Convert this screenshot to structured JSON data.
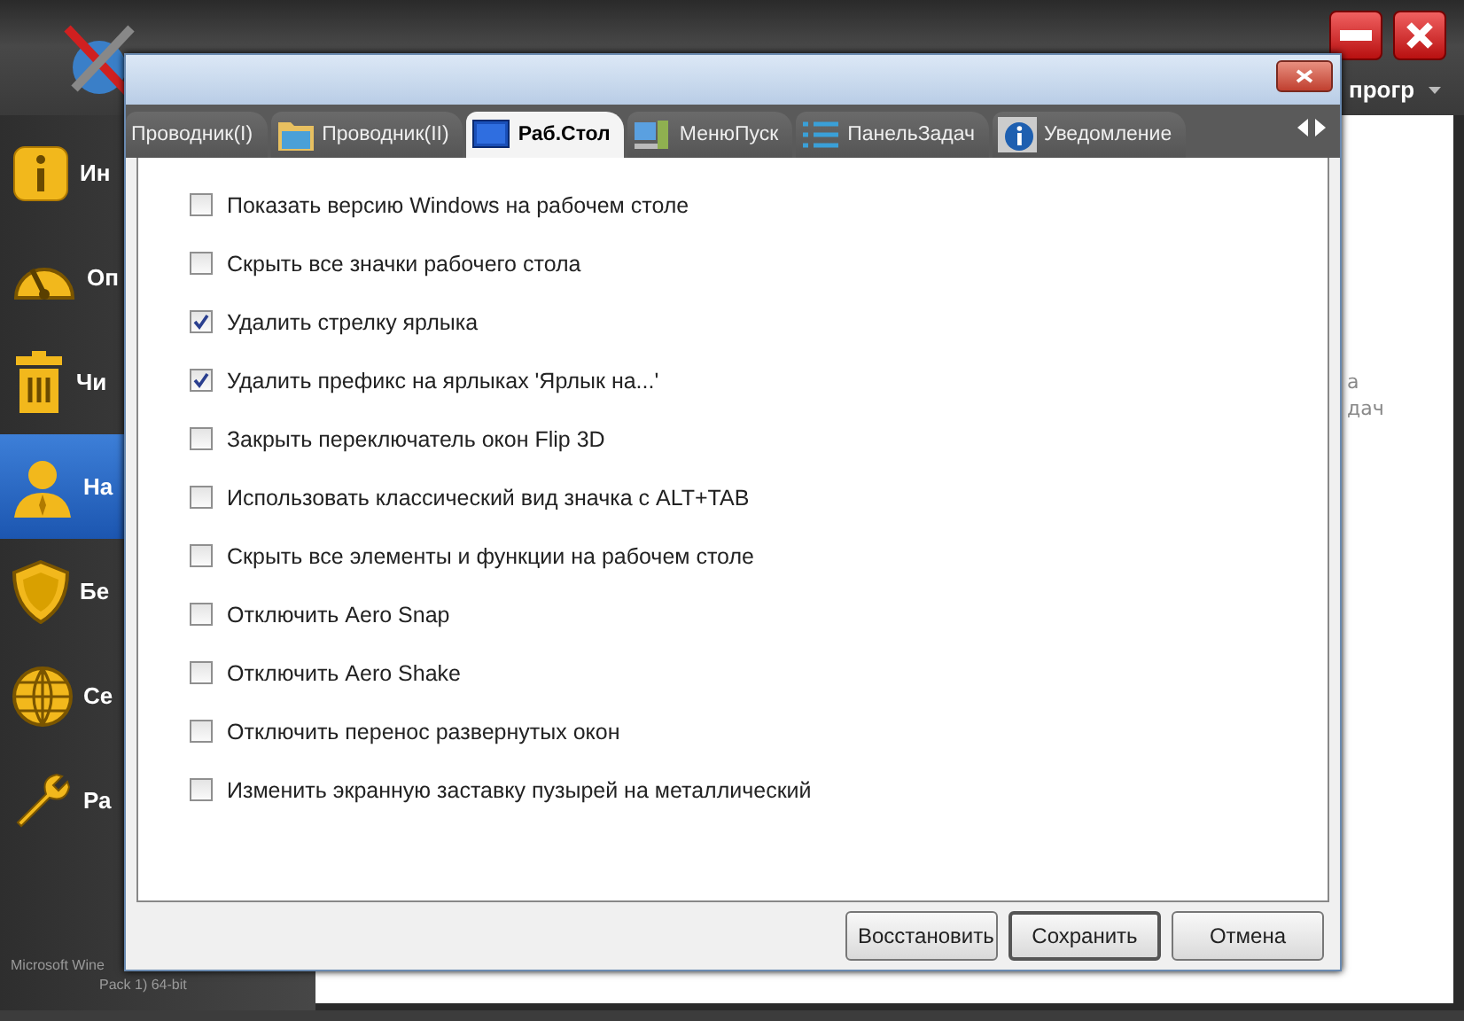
{
  "header": {
    "dropdown": "прогр"
  },
  "sidebar": {
    "items": [
      {
        "label": "Ин",
        "kind": "info",
        "selected": false
      },
      {
        "label": "Оп",
        "kind": "gauge",
        "selected": false
      },
      {
        "label": "Чи",
        "kind": "trash",
        "selected": false
      },
      {
        "label": "На",
        "kind": "person",
        "selected": true
      },
      {
        "label": "Бе",
        "kind": "shield",
        "selected": false
      },
      {
        "label": "Се",
        "kind": "globe",
        "selected": false
      },
      {
        "label": "Ра",
        "kind": "wrench",
        "selected": false
      }
    ],
    "footer": [
      "Microsoft Wine",
      "Pack 1) 64-bit"
    ]
  },
  "content": {
    "texts": [
      "а",
      "дач"
    ]
  },
  "dialog": {
    "tabs": [
      {
        "label": "Проводник(I)",
        "kind": "none",
        "selected": false
      },
      {
        "label": "Проводник(II)",
        "kind": "folder",
        "selected": false
      },
      {
        "label": "Раб.Стол",
        "kind": "desktop",
        "selected": true
      },
      {
        "label": "МенюПуск",
        "kind": "start",
        "selected": false
      },
      {
        "label": "ПанельЗадач",
        "kind": "taskbar",
        "selected": false
      },
      {
        "label": "Уведомление",
        "kind": "info",
        "selected": false
      }
    ],
    "options": [
      {
        "label": "Показать версию Windows на рабочем столе",
        "checked": false
      },
      {
        "label": "Скрыть все значки рабочего стола",
        "checked": false
      },
      {
        "label": "Удалить стрелку ярлыка",
        "checked": true
      },
      {
        "label": "Удалить префикс на ярлыках 'Ярлык на...'",
        "checked": true
      },
      {
        "label": "Закрыть переключатель окон Flip 3D",
        "checked": false
      },
      {
        "label": "Использовать классический вид значка с ALT+TAB",
        "checked": false
      },
      {
        "label": "Скрыть все элементы и функции на рабочем столе",
        "checked": false
      },
      {
        "label": "Отключить Aero Snap",
        "checked": false
      },
      {
        "label": "Отключить Aero Shake",
        "checked": false
      },
      {
        "label": "Отключить перенос развернутых окон",
        "checked": false
      },
      {
        "label": "Изменить экранную заставку пузырей на металлический",
        "checked": false
      }
    ],
    "buttons": [
      {
        "label": "Восстановить",
        "default": false
      },
      {
        "label": "Сохранить",
        "default": true
      },
      {
        "label": "Отмена",
        "default": false
      }
    ]
  }
}
